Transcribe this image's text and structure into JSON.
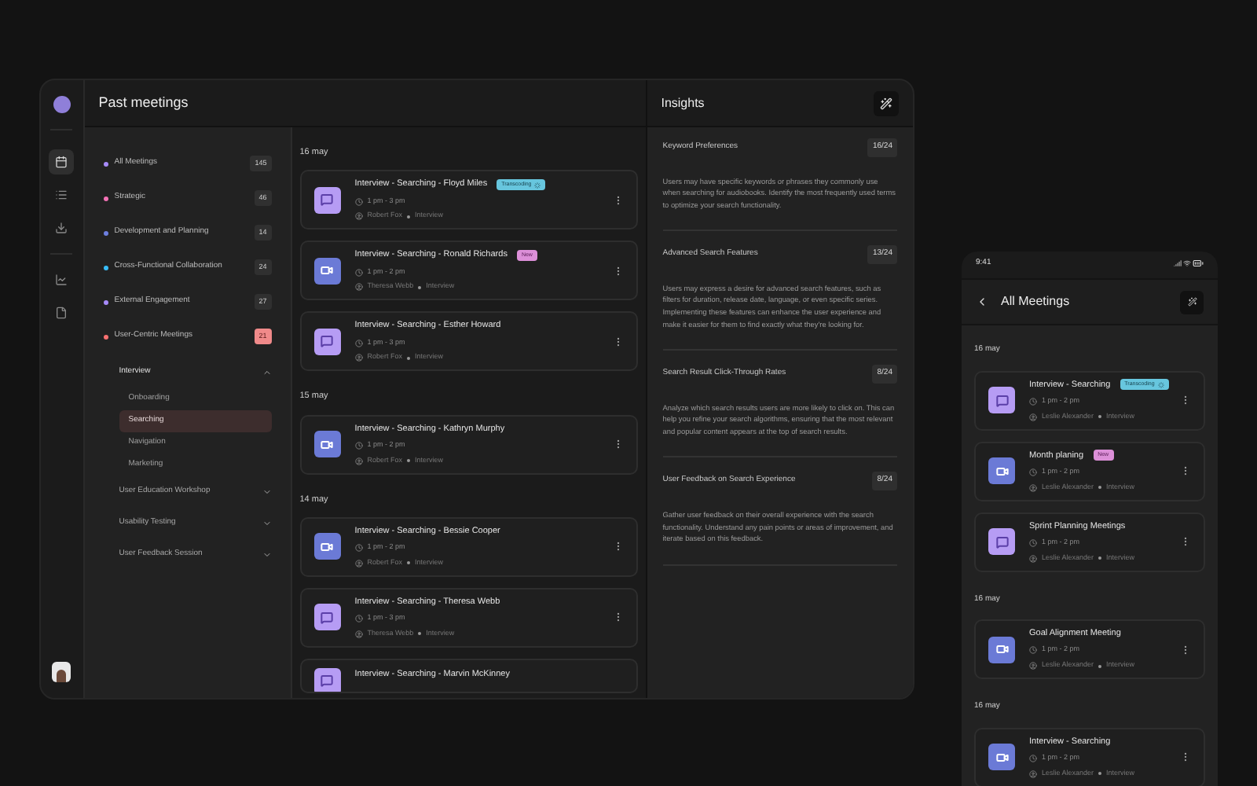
{
  "rail": [
    {
      "kind": "calendar",
      "selected": true
    },
    {
      "kind": "list",
      "selected": false
    },
    {
      "kind": "download",
      "selected": false
    },
    {
      "kind": "chart",
      "selected": false
    },
    {
      "kind": "document",
      "selected": false
    }
  ],
  "header": {
    "title": "Past meetings"
  },
  "sidebar": {
    "categories": [
      {
        "name": "All Meetings",
        "count": "145",
        "color": "#a78bfa",
        "alert": false
      },
      {
        "name": "Strategic",
        "count": "46",
        "color": "#f472b6",
        "alert": false
      },
      {
        "name": "Development and Planning",
        "count": "14",
        "color": "#6d7fe0",
        "alert": false
      },
      {
        "name": "Cross-Functional Collaboration",
        "count": "24",
        "color": "#38bdf8",
        "alert": false
      },
      {
        "name": "External Engagement",
        "count": "27",
        "color": "#a78bfa",
        "alert": false
      },
      {
        "name": "User-Centric Meetings",
        "count": "21",
        "color": "#f87171",
        "alert": true
      }
    ],
    "groups": [
      {
        "name": "Interview",
        "expanded": true,
        "children": [
          {
            "name": "Onboarding",
            "selected": false
          },
          {
            "name": "Searching",
            "selected": true
          },
          {
            "name": "Navigation",
            "selected": false
          },
          {
            "name": "Marketing",
            "selected": false
          }
        ]
      },
      {
        "name": "User Education Workshop",
        "expanded": false
      },
      {
        "name": "Usability Testing",
        "expanded": false
      },
      {
        "name": "User Feedback Session",
        "expanded": false
      }
    ]
  },
  "meetings": [
    {
      "date": "16 may",
      "items": [
        {
          "title": "Interview - Searching - Floyd Miles",
          "time": "1 pm - 3 pm",
          "person": "Robert Fox",
          "type": "Interview",
          "kind": "audio",
          "badge": {
            "kind": "transcoding",
            "text": "Transcoding"
          }
        },
        {
          "title": "Interview - Searching - Ronald Richards",
          "time": "1 pm - 2 pm",
          "person": "Theresa Webb",
          "type": "Interview",
          "kind": "video",
          "badge": {
            "kind": "new",
            "text": "New"
          }
        },
        {
          "title": "Interview - Searching - Esther Howard",
          "time": "1 pm - 3 pm",
          "person": "Robert Fox",
          "type": "Interview",
          "kind": "audio"
        }
      ]
    },
    {
      "date": "15 may",
      "items": [
        {
          "title": "Interview - Searching - Kathryn Murphy",
          "time": "1 pm - 2 pm",
          "person": "Robert Fox",
          "type": "Interview",
          "kind": "video"
        }
      ]
    },
    {
      "date": "14 may",
      "items": [
        {
          "title": "Interview - Searching - Bessie Cooper",
          "time": "1 pm - 2 pm",
          "person": "Robert Fox",
          "type": "Interview",
          "kind": "video"
        },
        {
          "title": "Interview - Searching - Theresa Webb",
          "time": "1 pm - 3 pm",
          "person": "Theresa Webb",
          "type": "Interview",
          "kind": "audio"
        },
        {
          "title": "Interview - Searching - Marvin McKinney",
          "kind": "audio"
        }
      ]
    }
  ],
  "insights": {
    "title": "Insights",
    "items": [
      {
        "title": "Keyword Preferences",
        "score": "16/24",
        "body": "Users may have specific keywords or phrases they commonly use when searching for audiobooks. Identify the most frequently used terms to optimize your search functionality."
      },
      {
        "title": "Advanced Search Features",
        "score": "13/24",
        "body": "Users may express a desire for advanced search features, such as filters for duration, release date, language, or even specific series. Implementing these features can enhance the user experience and make it easier for them to find exactly what they're looking for."
      },
      {
        "title": "Search Result Click-Through Rates",
        "score": "8/24",
        "body": "Analyze which search results users are more likely to click on. This can help you refine your search algorithms, ensuring that the most relevant and popular content appears at the top of search results."
      },
      {
        "title": "User Feedback on Search Experience",
        "score": "8/24",
        "body": "Gather user feedback on their overall experience with the search functionality. Understand any pain points or areas of improvement, and iterate based on this feedback."
      }
    ]
  },
  "mobile": {
    "time": "9:41",
    "title": "All Meetings",
    "days": [
      {
        "date": "16 may",
        "items": [
          {
            "title": "Interview - Searching",
            "time": "1 pm - 2 pm",
            "person": "Leslie Alexander",
            "type": "Interview",
            "kind": "audio",
            "badge": {
              "kind": "transcoding",
              "text": "Transcoding"
            }
          },
          {
            "title": "Month planing",
            "time": "1 pm - 2 pm",
            "person": "Leslie Alexander",
            "type": "Interview",
            "kind": "video",
            "badge": {
              "kind": "new",
              "text": "New"
            }
          },
          {
            "title": "Sprint Planning Meetings",
            "time": "1 pm - 2 pm",
            "person": "Leslie Alexander",
            "type": "Interview",
            "kind": "audio"
          }
        ]
      },
      {
        "date": "16 may",
        "items": [
          {
            "title": "Goal Alignment Meeting",
            "time": "1 pm - 2 pm",
            "person": "Leslie Alexander",
            "type": "Interview",
            "kind": "video"
          }
        ]
      },
      {
        "date": "16 may",
        "items": [
          {
            "title": "Interview - Searching",
            "time": "1 pm - 2 pm",
            "person": "Leslie Alexander",
            "type": "Interview",
            "kind": "video"
          }
        ]
      }
    ]
  }
}
